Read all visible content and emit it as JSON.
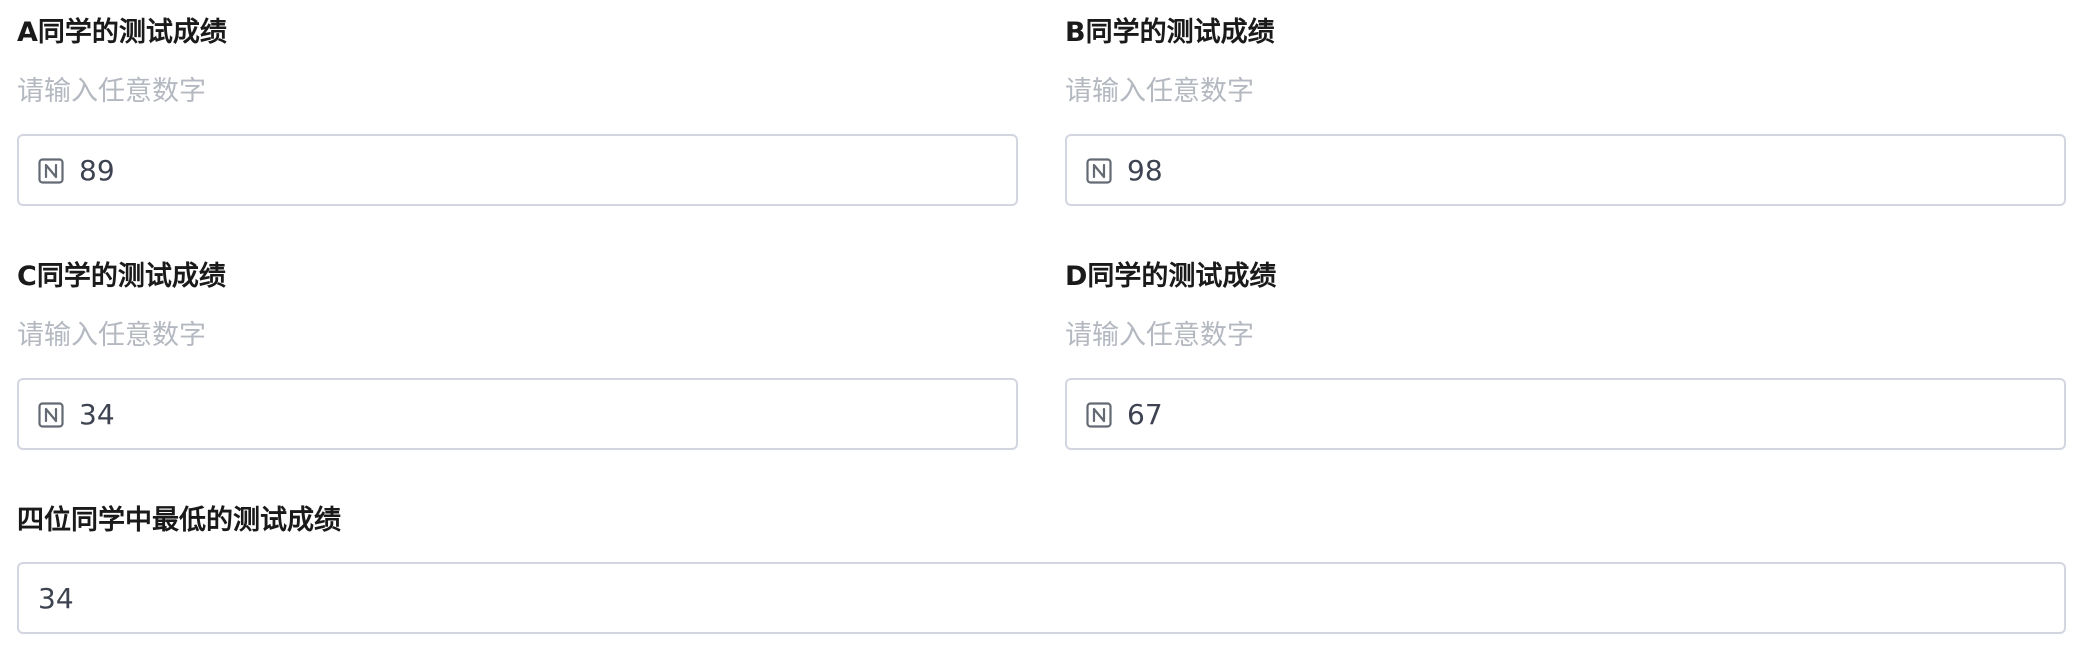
{
  "fields": [
    {
      "label": "A同学的测试成绩",
      "hint": "请输入任意数字",
      "value": "89",
      "icon": "number-field-icon"
    },
    {
      "label": "B同学的测试成绩",
      "hint": "请输入任意数字",
      "value": "98",
      "icon": "number-field-icon"
    },
    {
      "label": "C同学的测试成绩",
      "hint": "请输入任意数字",
      "value": "34",
      "icon": "number-field-icon"
    },
    {
      "label": "D同学的测试成绩",
      "hint": "请输入任意数字",
      "value": "67",
      "icon": "number-field-icon"
    }
  ],
  "result": {
    "label": "四位同学中最低的测试成绩",
    "value": "34"
  },
  "colors": {
    "label_text": "#1a1a1a",
    "hint_text": "#b4b8c0",
    "input_border": "#d3d6e0",
    "value_text": "#3d4350",
    "icon_stroke": "#646a73"
  }
}
